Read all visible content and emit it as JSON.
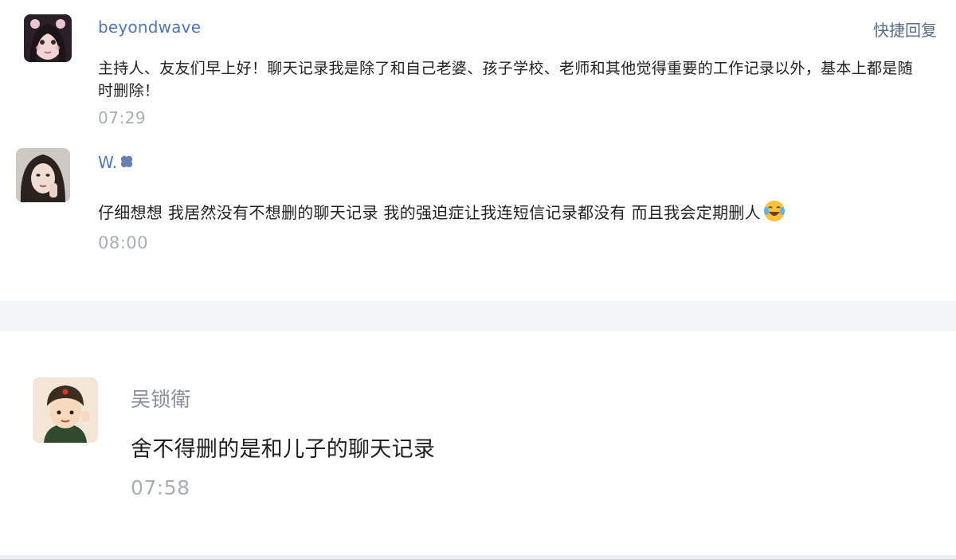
{
  "quick_reply_label": "快捷回复",
  "comments": [
    {
      "username": "beyondwave",
      "text": "主持人、友友们早上好！聊天记录我是除了和自己老婆、孩子学校、老师和其他觉得重要的工作记录以外，基本上都是随时删除！",
      "time": "07:29",
      "avatar": "girl-cartoon-avatar"
    },
    {
      "username": "W.",
      "username_icon": "clover-icon",
      "text": "仔细想想 我居然没有不想删的聊天记录 我的强迫症让我连短信记录都没有 而且我会定期删人",
      "text_icon": "laughing-crying-emoji-icon",
      "time": "08:00",
      "avatar": "woman-photo-avatar"
    },
    {
      "username": "吴锁衛",
      "text": "舍不得删的是和儿子的聊天记录",
      "time": "07:58",
      "avatar": "cartoon-soldier-avatar"
    }
  ],
  "colors": {
    "username_blue": "#4b76b8",
    "timestamp_gray": "#a9adb5",
    "separator": "#f3f5f8"
  }
}
